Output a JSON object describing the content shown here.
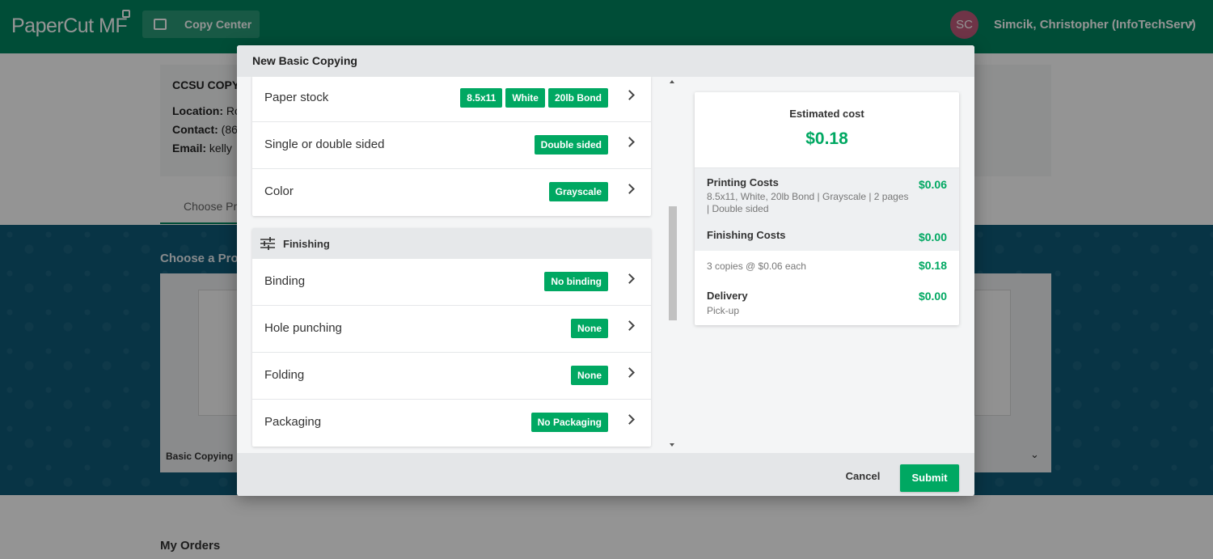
{
  "app": {
    "logo": "PaperCut MF",
    "nav_button": "Copy Center",
    "user_initials": "SC",
    "user_name": "Simcik, Christopher (InfoTechServ)"
  },
  "background": {
    "shop_title": "CCSU COPY C",
    "location_label": "Location:",
    "location_value": "Ro",
    "contact_label": "Contact:",
    "contact_value": "(86",
    "email_label": "Email:",
    "email_value": "kelly",
    "tab_first": "Choose Pro",
    "choose_title": "Choose a Pro",
    "product_label": "Basic Copying",
    "my_orders": "My Orders"
  },
  "modal": {
    "title": "New Basic Copying",
    "options": [
      {
        "label": "Paper stock",
        "badges": [
          "8.5x11",
          "White",
          "20lb Bond"
        ]
      },
      {
        "label": "Single or double sided",
        "badges": [
          "Double sided"
        ]
      },
      {
        "label": "Color",
        "badges": [
          "Grayscale"
        ]
      }
    ],
    "finishing": {
      "title": "Finishing",
      "options": [
        {
          "label": "Binding",
          "badges": [
            "No binding"
          ]
        },
        {
          "label": "Hole punching",
          "badges": [
            "None"
          ]
        },
        {
          "label": "Folding",
          "badges": [
            "None"
          ]
        },
        {
          "label": "Packaging",
          "badges": [
            "No Packaging"
          ]
        }
      ]
    },
    "cost": {
      "caption": "Estimated cost",
      "total": "$0.18",
      "printing_label": "Printing Costs",
      "printing_detail": "8.5x11, White, 20lb Bond | Grayscale | 2 pages | Double sided",
      "printing_amount": "$0.06",
      "finishing_label": "Finishing Costs",
      "finishing_amount": "$0.00",
      "copies_line": "3 copies @ $0.06 each",
      "copies_amount": "$0.18",
      "delivery_label": "Delivery",
      "delivery_detail": "Pick-up",
      "delivery_amount": "$0.00"
    },
    "cancel": "Cancel",
    "submit": "Submit"
  },
  "colors": {
    "brand_green": "#00855f",
    "badge_green": "#00a862"
  }
}
